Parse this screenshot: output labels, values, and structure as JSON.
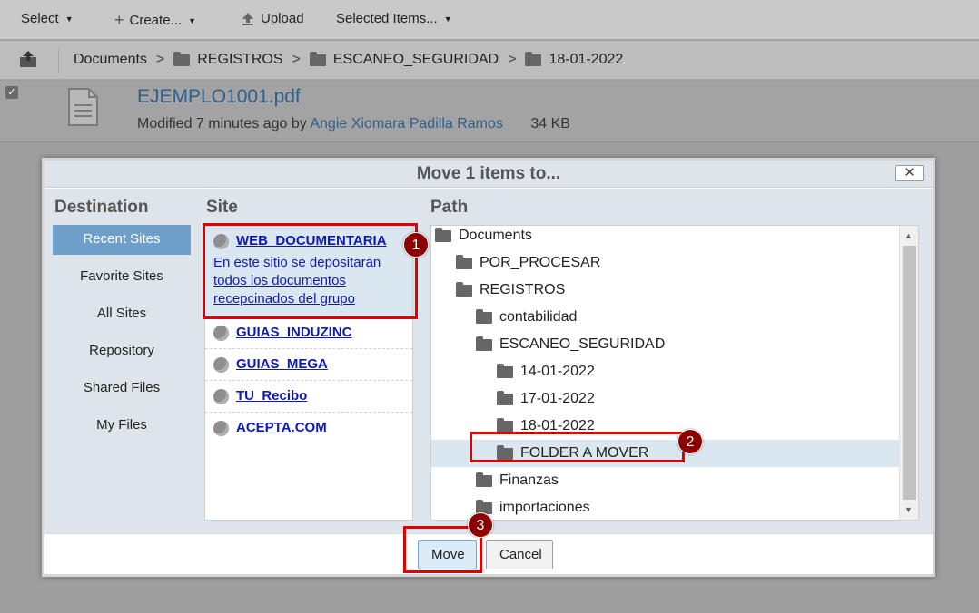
{
  "toolbar": {
    "select_label": "Select",
    "create_label": "Create...",
    "upload_label": "Upload",
    "selected_items_label": "Selected Items..."
  },
  "breadcrumb": [
    "Documents",
    "REGISTROS",
    "ESCANEO_SEGURIDAD",
    "18-01-2022"
  ],
  "document": {
    "name": "EJEMPLO1001.pdf",
    "modified_prefix": "Modified 7 minutes ago by",
    "author": "Angie Xiomara Padilla Ramos",
    "size": "34 KB"
  },
  "dialog": {
    "title": "Move 1 items to...",
    "close_label": "✕",
    "destination_title": "Destination",
    "site_title": "Site",
    "path_title": "Path",
    "destinations": [
      "Recent Sites",
      "Favorite Sites",
      "All Sites",
      "Repository",
      "Shared Files",
      "My Files"
    ],
    "sites": [
      {
        "name": "WEB_DOCUMENTARIA",
        "description": "En este sitio se depositaran todos los documentos recepcinados del grupo"
      },
      {
        "name": "GUIAS_INDUZINC",
        "description": ""
      },
      {
        "name": "GUIAS_MEGA",
        "description": ""
      },
      {
        "name": "TU_Recibo",
        "description": ""
      },
      {
        "name": "ACEPTA.COM",
        "description": ""
      }
    ],
    "tree": [
      "Documents",
      "POR_PROCESAR",
      "REGISTROS",
      "contabilidad",
      "ESCANEO_SEGURIDAD",
      "14-01-2022",
      "17-01-2022",
      "18-01-2022",
      "FOLDER A MOVER",
      "Finanzas",
      "importaciones"
    ],
    "move_label": "Move",
    "cancel_label": "Cancel"
  },
  "callouts": [
    "1",
    "2",
    "3"
  ],
  "colors": {
    "highlight": "#e00000",
    "badge": "#8b0000",
    "active_destination": "#6e9fca",
    "link": "#0f1ab6"
  }
}
